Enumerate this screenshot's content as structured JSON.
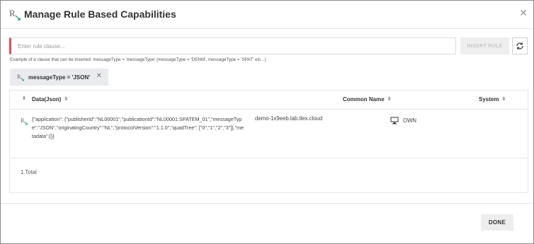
{
  "dialog": {
    "title": "Manage Rule Based Capabilities",
    "close_symbol": "✕"
  },
  "rule_input": {
    "placeholder": "Enter rule clause...",
    "value": ""
  },
  "insert_button": {
    "label": "INSERT RULE"
  },
  "refresh_button": {
    "icon": "refresh-icon"
  },
  "example_text": "Example of a clause that can be inserted: messageType = 'messageType' (messageType = 'DENM', messageType = 'SPAT' etc...)",
  "chips": [
    {
      "label": "messageType = 'JSON'",
      "remove_symbol": "✕"
    }
  ],
  "table": {
    "columns": [
      {
        "label": "Data(Json)",
        "sortable": true
      },
      {
        "label": "Common Name",
        "sortable": true
      },
      {
        "label": "System",
        "sortable": true
      }
    ],
    "rows": [
      {
        "data_json": "{\"application\": {\"publisherId\":\"NL00001\",\"publicationId\":\"NL00001:SPATEM_01\",\"messageType\":\"JSON\",\"originatingCountry\":\"NL\",\"protocolVersion\":\"1.1.0\",\"quadTree\": [\"0\",\"1\",\"2\",\"3\"]},\"metadata\":{}}",
        "common_name": "demo-1x9eeb.lab.tlex.cloud",
        "system": "OWN",
        "system_icon": "monitor-icon"
      }
    ],
    "total_text": "1 Total"
  },
  "done_button": {
    "label": "DONE"
  },
  "colors": {
    "accent_invalid": "#e24c5a",
    "logo_green": "#3a9a8a",
    "chip_bg": "#e9ebef"
  }
}
